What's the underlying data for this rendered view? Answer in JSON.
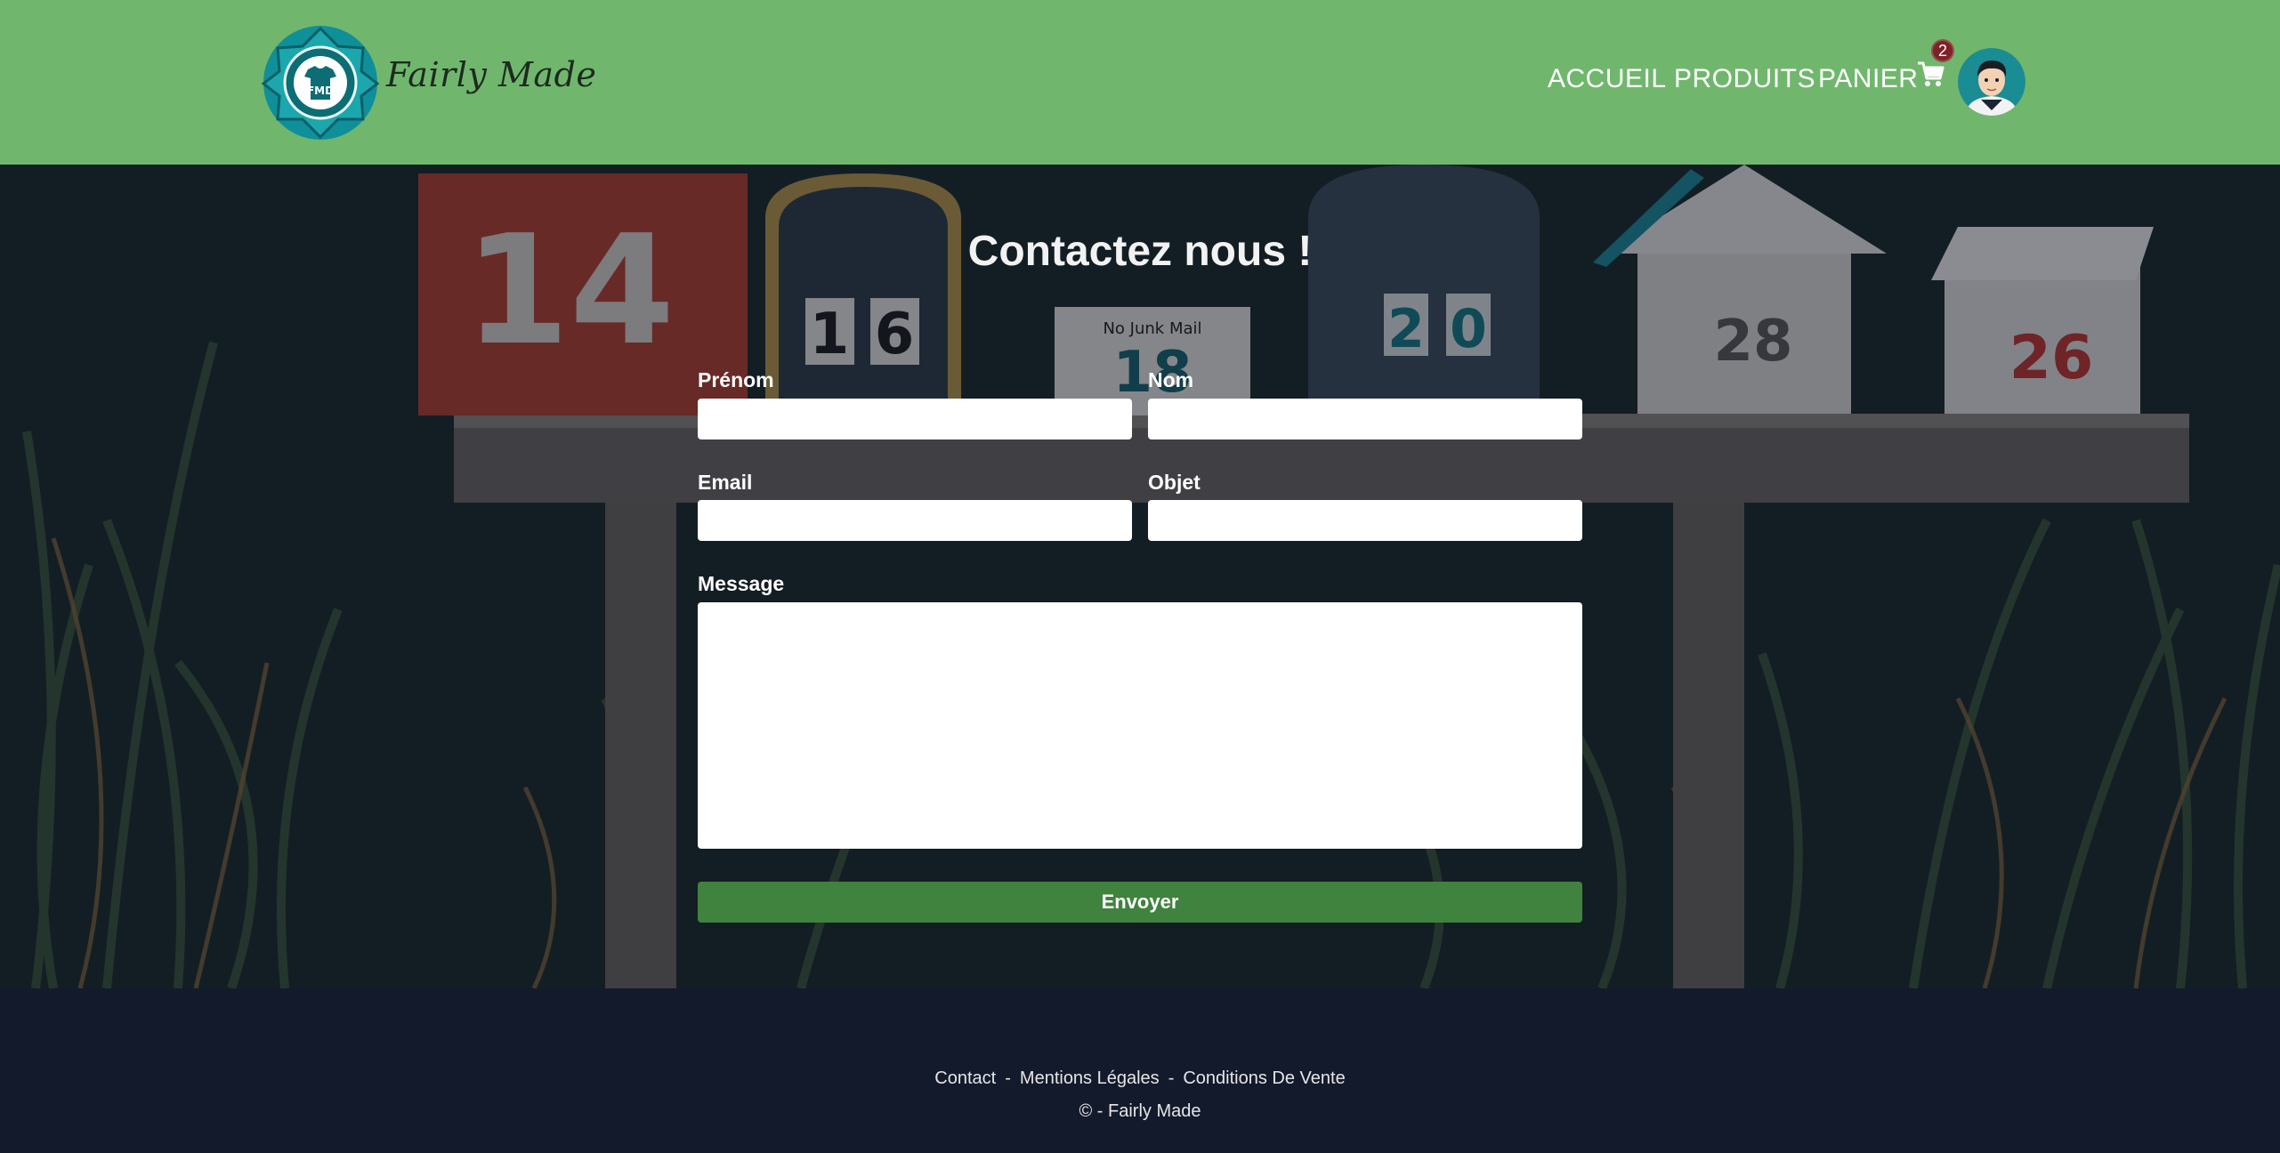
{
  "header": {
    "brand": "Fairly Made",
    "logo_text": "FMD",
    "nav": {
      "accueil": "ACCUEIL",
      "produits": "PRODUITS",
      "panier": "PANIER"
    },
    "cart_count": "2",
    "colors": {
      "background": "#70b76d",
      "badge": "#7d2226"
    }
  },
  "hero": {
    "title": "Contactez nous !",
    "form": {
      "prenom_label": "Prénom",
      "prenom_value": "",
      "nom_label": "Nom",
      "nom_value": "",
      "email_label": "Email",
      "email_value": "",
      "objet_label": "Objet",
      "objet_value": "",
      "message_label": "Message",
      "message_value": "",
      "submit_label": "Envoyer"
    },
    "mailbox_numbers": [
      "14",
      "16",
      "18",
      "20",
      "28",
      "26"
    ],
    "mailbox_notice": "No Junk Mail",
    "colors": {
      "button": "#3f833e"
    }
  },
  "footer": {
    "links": [
      "Contact",
      "Mentions Légales",
      "Conditions De Vente"
    ],
    "separator": "-",
    "copyright": "© - Fairly Made",
    "colors": {
      "background": "#131a2c"
    }
  }
}
